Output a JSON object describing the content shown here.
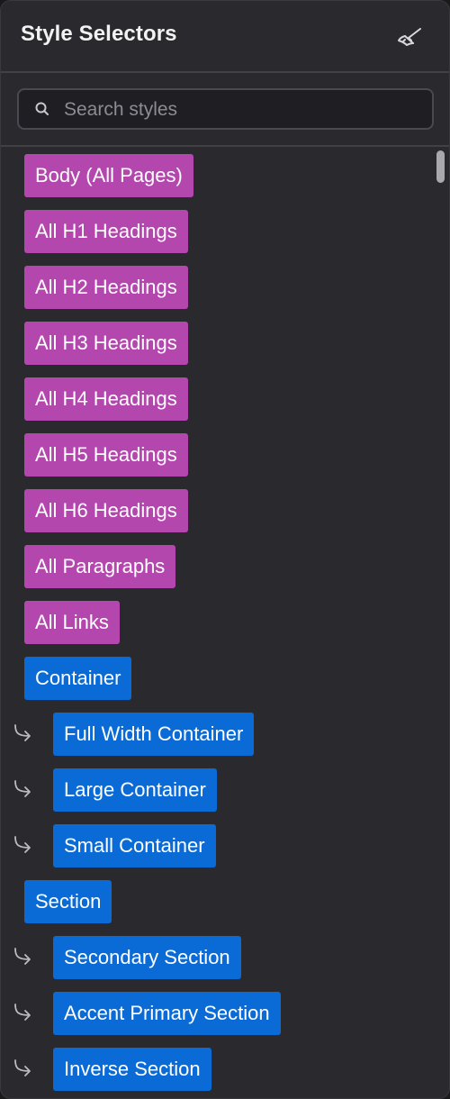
{
  "panel": {
    "title": "Style Selectors",
    "icons": {
      "header_action": "paintbrush-icon",
      "search": "search-icon",
      "child": "child-arrow-icon"
    }
  },
  "search": {
    "placeholder": "Search styles",
    "value": ""
  },
  "colors": {
    "tag_element": "#b347ae",
    "tag_class": "#0b6bd6",
    "panel_bg": "#2a292d"
  },
  "selectors": [
    {
      "label": "Body (All Pages)",
      "kind": "element",
      "child": false
    },
    {
      "label": "All H1 Headings",
      "kind": "element",
      "child": false
    },
    {
      "label": "All H2 Headings",
      "kind": "element",
      "child": false
    },
    {
      "label": "All H3 Headings",
      "kind": "element",
      "child": false
    },
    {
      "label": "All H4 Headings",
      "kind": "element",
      "child": false
    },
    {
      "label": "All H5 Headings",
      "kind": "element",
      "child": false
    },
    {
      "label": "All H6 Headings",
      "kind": "element",
      "child": false
    },
    {
      "label": "All Paragraphs",
      "kind": "element",
      "child": false
    },
    {
      "label": "All Links",
      "kind": "element",
      "child": false
    },
    {
      "label": "Container",
      "kind": "class",
      "child": false
    },
    {
      "label": "Full Width Container",
      "kind": "class",
      "child": true
    },
    {
      "label": "Large Container",
      "kind": "class",
      "child": true
    },
    {
      "label": "Small Container",
      "kind": "class",
      "child": true
    },
    {
      "label": "Section",
      "kind": "class",
      "child": false
    },
    {
      "label": "Secondary Section",
      "kind": "class",
      "child": true
    },
    {
      "label": "Accent Primary Section",
      "kind": "class",
      "child": true
    },
    {
      "label": "Inverse Section",
      "kind": "class",
      "child": true
    }
  ]
}
